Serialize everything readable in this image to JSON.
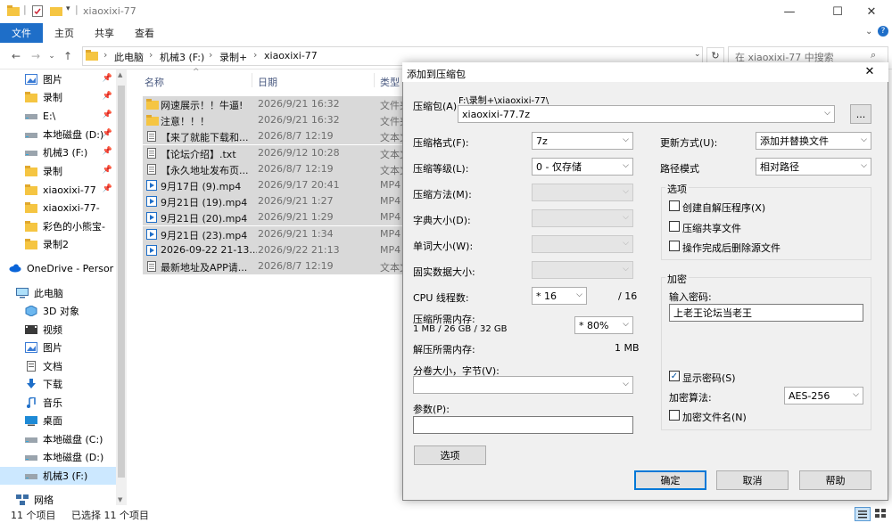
{
  "explorer": {
    "title": "xiaoxixi-77",
    "ribbon_tabs": [
      "文件",
      "主页",
      "共享",
      "查看"
    ],
    "breadcrumb": [
      "此电脑",
      "机械3 (F:)",
      "录制+",
      "xiaoxixi-77"
    ],
    "search_placeholder": "在 xiaoxixi-77 中搜索",
    "columns": {
      "name": "名称",
      "date": "日期",
      "type": "类型"
    },
    "sidebar": [
      {
        "label": "图片",
        "icon": "pictures-icon",
        "pinned": true
      },
      {
        "label": "录制",
        "icon": "folder-icon",
        "pinned": true
      },
      {
        "label": "E:\\",
        "icon": "drive-icon",
        "pinned": true
      },
      {
        "label": "本地磁盘 (D:)",
        "icon": "drive-icon",
        "pinned": true
      },
      {
        "label": "机械3 (F:)",
        "icon": "drive-icon",
        "pinned": true
      },
      {
        "label": "录制",
        "icon": "folder-icon",
        "pinned": true
      },
      {
        "label": "xiaoxixi-77",
        "icon": "folder-icon",
        "pinned": true
      },
      {
        "label": "xiaoxixi-77-",
        "icon": "folder-icon",
        "pinned": false
      },
      {
        "label": "彩色的小熊宝-",
        "icon": "folder-icon",
        "pinned": false
      },
      {
        "label": "录制2",
        "icon": "folder-icon",
        "pinned": false
      },
      {
        "label": "OneDrive - Persor",
        "icon": "cloud-icon",
        "pinned": false
      },
      {
        "label": "此电脑",
        "icon": "computer-icon",
        "pinned": false
      },
      {
        "label": "3D 对象",
        "icon": "cube-icon",
        "pinned": false
      },
      {
        "label": "视频",
        "icon": "video-icon",
        "pinned": false
      },
      {
        "label": "图片",
        "icon": "pictures-icon",
        "pinned": false
      },
      {
        "label": "文档",
        "icon": "document-icon",
        "pinned": false
      },
      {
        "label": "下载",
        "icon": "download-icon",
        "pinned": false
      },
      {
        "label": "音乐",
        "icon": "music-icon",
        "pinned": false
      },
      {
        "label": "桌面",
        "icon": "desktop-icon",
        "pinned": false
      },
      {
        "label": "本地磁盘 (C:)",
        "icon": "drive-icon",
        "pinned": false
      },
      {
        "label": "本地磁盘 (D:)",
        "icon": "drive-icon",
        "pinned": false
      },
      {
        "label": "机械3 (F:)",
        "icon": "drive-icon",
        "pinned": false
      },
      {
        "label": "网络",
        "icon": "network-icon",
        "pinned": false
      }
    ],
    "files": [
      {
        "name": "网速展示！！牛逼!",
        "date": "2026/9/21 16:32",
        "type": "文件夹",
        "icon": "folder-icon"
      },
      {
        "name": "注意！！！",
        "date": "2026/9/21 16:32",
        "type": "文件夹",
        "icon": "folder-icon"
      },
      {
        "name": "【来了就能下载和...",
        "date": "2026/8/7 12:19",
        "type": "文本文",
        "icon": "text-file-icon"
      },
      {
        "name": "【论坛介绍】.txt",
        "date": "2026/9/12 10:28",
        "type": "文本文",
        "icon": "text-file-icon"
      },
      {
        "name": "【永久地址发布页...",
        "date": "2026/8/7 12:19",
        "type": "文本文",
        "icon": "text-file-icon"
      },
      {
        "name": "9月17日 (9).mp4",
        "date": "2026/9/17 20:41",
        "type": "MP4",
        "icon": "video-file-icon"
      },
      {
        "name": "9月21日 (19).mp4",
        "date": "2026/9/21 1:27",
        "type": "MP4",
        "icon": "video-file-icon"
      },
      {
        "name": "9月21日 (20).mp4",
        "date": "2026/9/21 1:29",
        "type": "MP4",
        "icon": "video-file-icon"
      },
      {
        "name": "9月21日 (23).mp4",
        "date": "2026/9/21 1:34",
        "type": "MP4",
        "icon": "video-file-icon"
      },
      {
        "name": "2026-09-22 21-13...",
        "date": "2026/9/22 21:13",
        "type": "MP4",
        "icon": "video-file-icon"
      },
      {
        "name": "最新地址及APP请...",
        "date": "2026/8/7 12:19",
        "type": "文本文",
        "icon": "text-file-icon"
      }
    ],
    "status_count": "11 个项目",
    "status_selected": "已选择 11 个项目"
  },
  "dialog": {
    "title": "添加到压缩包",
    "archive_label": "压缩包(A)",
    "archive_path": "F:\\录制+\\xiaoxixi-77\\",
    "archive_name": "xiaoxixi-77.7z",
    "browse_label": "...",
    "format_label": "压缩格式(F):",
    "format_value": "7z",
    "level_label": "压缩等级(L):",
    "level_value": "0 - 仅存储",
    "method_label": "压缩方法(M):",
    "dict_label": "字典大小(D):",
    "word_label": "单词大小(W):",
    "solid_label": "固实数据大小:",
    "threads_label": "CPU 线程数:",
    "threads_value": "* 16",
    "threads_total": "/ 16",
    "mem_label": "压缩所需内存:",
    "mem_detail": "1 MB / 26 GB / 32 GB",
    "mem_value": "* 80%",
    "decomp_label": "解压所需内存:",
    "decomp_value": "1 MB",
    "split_label": "分卷大小，字节(V):",
    "params_label": "参数(P):",
    "options_btn": "选项",
    "update_label": "更新方式(U):",
    "update_value": "添加并替换文件",
    "path_label": "路径模式",
    "path_value": "相对路径",
    "options_group": "选项",
    "opt_sfx": "创建自解压程序(X)",
    "opt_shared": "压缩共享文件",
    "opt_delete": "操作完成后删除源文件",
    "encrypt_group": "加密",
    "password_label": "输入密码:",
    "password_value": "上老王论坛当老王",
    "show_password": "显示密码(S)",
    "enc_method_label": "加密算法:",
    "enc_method_value": "AES-256",
    "encrypt_names": "加密文件名(N)",
    "ok": "确定",
    "cancel": "取消",
    "help": "帮助"
  }
}
